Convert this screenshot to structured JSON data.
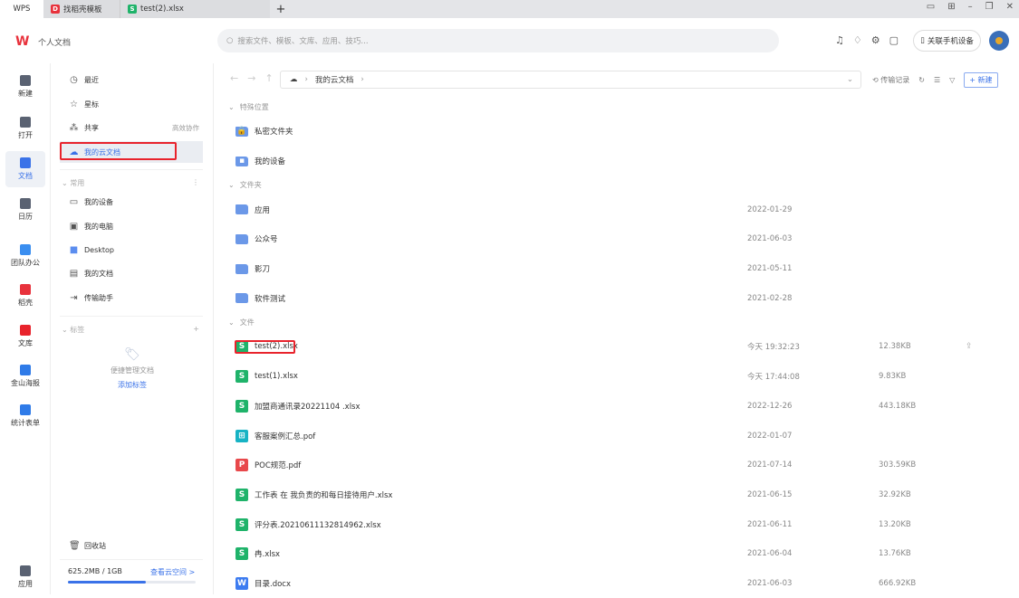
{
  "tabs": [
    {
      "label": "WPS"
    },
    {
      "label": "找稻壳模板"
    },
    {
      "label": "test(2).xlsx"
    }
  ],
  "header": {
    "title": "个人文档",
    "search_placeholder": "搜索文件、模板、文库、应用、技巧...",
    "phone_button": "关联手机设备"
  },
  "rail": [
    {
      "label": "新建",
      "color": "#5a6272"
    },
    {
      "label": "打开",
      "color": "#5a6272"
    },
    {
      "label": "文档",
      "color": "#3a72e8"
    },
    {
      "label": "日历",
      "color": "#5a6272"
    },
    {
      "label": "团队办公",
      "color": "#3a8ef0"
    },
    {
      "label": "稻壳",
      "color": "#e8323c"
    },
    {
      "label": "文库",
      "color": "#e8232c"
    },
    {
      "label": "金山海报",
      "color": "#2f7be8"
    },
    {
      "label": "统计表单",
      "color": "#2f7be8"
    },
    {
      "label": "应用",
      "color": "#5a6272"
    }
  ],
  "sidebar": {
    "top": [
      {
        "label": "最近",
        "icon": "clock"
      },
      {
        "label": "星标",
        "icon": "star"
      },
      {
        "label": "共享",
        "icon": "share",
        "extra": "高效协作"
      },
      {
        "label": "我的云文档",
        "icon": "cloud"
      }
    ],
    "common_label": "常用",
    "common": [
      {
        "label": "我的设备"
      },
      {
        "label": "我的电脑"
      },
      {
        "label": "Desktop"
      },
      {
        "label": "我的文档"
      },
      {
        "label": "传输助手"
      }
    ],
    "tags_label": "标签",
    "tags_hint": "便捷管理文档",
    "tags_add": "添加标签",
    "trash": "回收站",
    "storage": {
      "used": "625.2MB / 1GB",
      "link": "查看云空间 >",
      "fraction": 0.61
    }
  },
  "toolbar": {
    "breadcrumb": "我的云文档",
    "transfer": "传输记录",
    "new": "+ 新建"
  },
  "sections": {
    "special": {
      "label": "特殊位置",
      "items": [
        {
          "name": "私密文件夹"
        },
        {
          "name": "我的设备"
        }
      ]
    },
    "folders": {
      "label": "文件夹",
      "items": [
        {
          "name": "应用",
          "date": "2022-01-29"
        },
        {
          "name": "公众号",
          "date": "2021-06-03"
        },
        {
          "name": "影刀",
          "date": "2021-05-11"
        },
        {
          "name": "软件测试",
          "date": "2021-02-28"
        }
      ]
    },
    "files": {
      "label": "文件",
      "items": [
        {
          "name": "test(2).xlsx",
          "date": "今天 19:32:23",
          "size": "12.38KB",
          "type": "S",
          "color": "#1fb36a"
        },
        {
          "name": "test(1).xlsx",
          "date": "今天 17:44:08",
          "size": "9.83KB",
          "type": "S",
          "color": "#1fb36a"
        },
        {
          "name": "加盟商通讯录20221104 .xlsx",
          "date": "2022-12-26",
          "size": "443.18KB",
          "type": "S",
          "color": "#1fb36a"
        },
        {
          "name": "客服案例汇总.pof",
          "date": "2022-01-07",
          "size": "",
          "type": "⊞",
          "color": "#17b3c4"
        },
        {
          "name": "POC规范.pdf",
          "date": "2021-07-14",
          "size": "303.59KB",
          "type": "P",
          "color": "#e8484b"
        },
        {
          "name": "工作表 在 我负责的和每日接待用户.xlsx",
          "date": "2021-06-15",
          "size": "32.92KB",
          "type": "S",
          "color": "#1fb36a"
        },
        {
          "name": "评分表.20210611132814962.xlsx",
          "date": "2021-06-11",
          "size": "13.20KB",
          "type": "S",
          "color": "#1fb36a"
        },
        {
          "name": "冉.xlsx",
          "date": "2021-06-04",
          "size": "13.76KB",
          "type": "S",
          "color": "#1fb36a"
        },
        {
          "name": "目录.docx",
          "date": "2021-06-03",
          "size": "666.92KB",
          "type": "W",
          "color": "#3d7cf0"
        }
      ]
    }
  }
}
